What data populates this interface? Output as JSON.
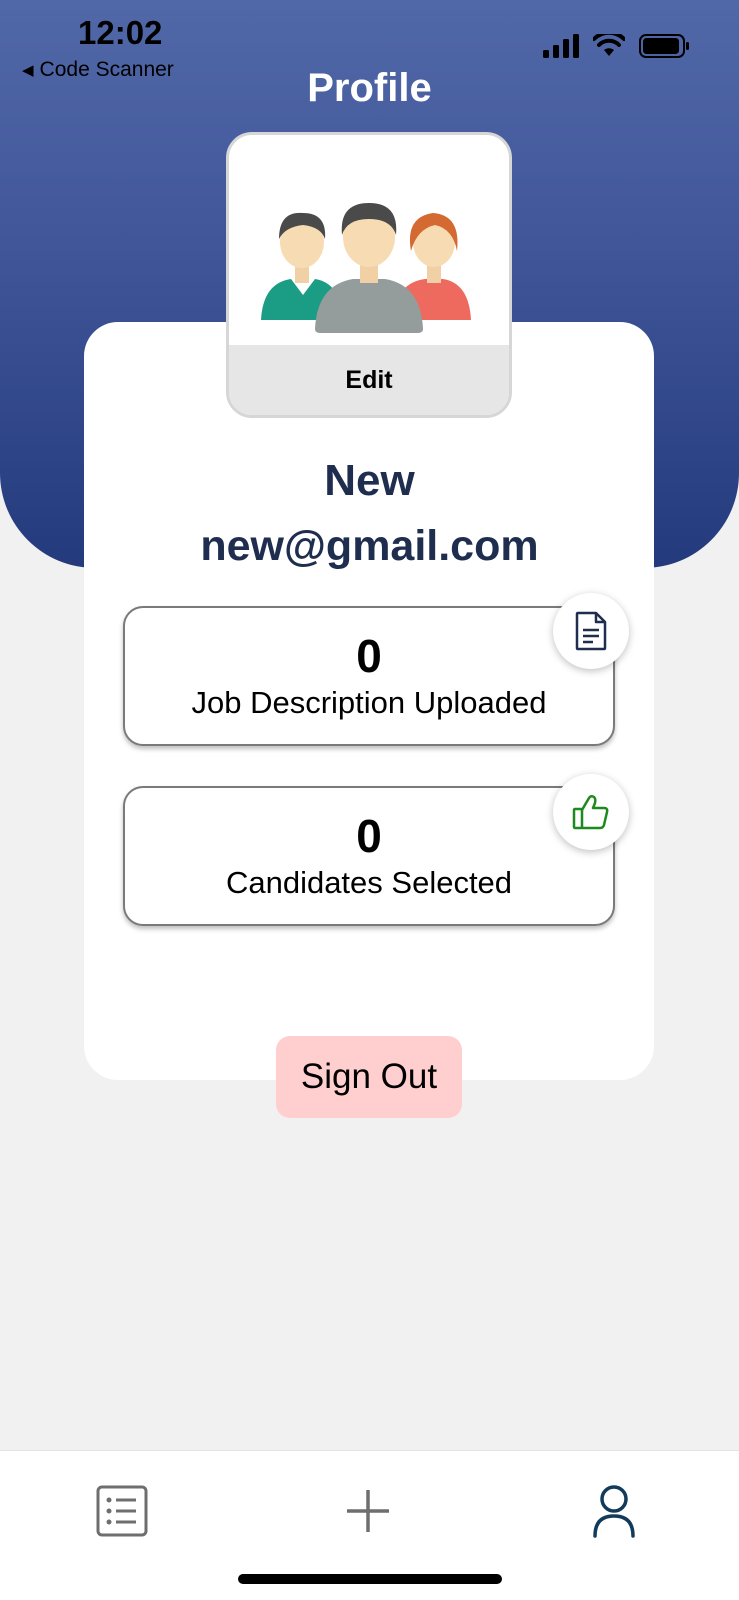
{
  "status_bar": {
    "time": "12:02",
    "back_label": "Code Scanner",
    "icons": [
      "signal-icon",
      "wifi-icon",
      "battery-icon"
    ]
  },
  "header": {
    "title": "Profile"
  },
  "avatar": {
    "image": "people-group-avatar",
    "edit_label": "Edit"
  },
  "user": {
    "name": "New",
    "email": "new@gmail.com"
  },
  "stats": [
    {
      "value": "0",
      "label": "Job Description Uploaded",
      "icon": "document-icon"
    },
    {
      "value": "0",
      "label": "Candidates Selected",
      "icon": "thumbs-up-icon"
    }
  ],
  "actions": {
    "sign_out_label": "Sign Out"
  },
  "tab_bar": {
    "tabs": [
      {
        "icon": "list-icon"
      },
      {
        "icon": "plus-icon"
      },
      {
        "icon": "profile-icon",
        "active": true
      }
    ]
  },
  "colors": {
    "header_gradient_top": "#5168a8",
    "header_gradient_bottom": "#233a7c",
    "name_text": "#1f2d4f",
    "sign_out_bg": "#ffcfcf",
    "thumbs_up": "#1e8a1e",
    "active_tab": "#123a5a"
  }
}
